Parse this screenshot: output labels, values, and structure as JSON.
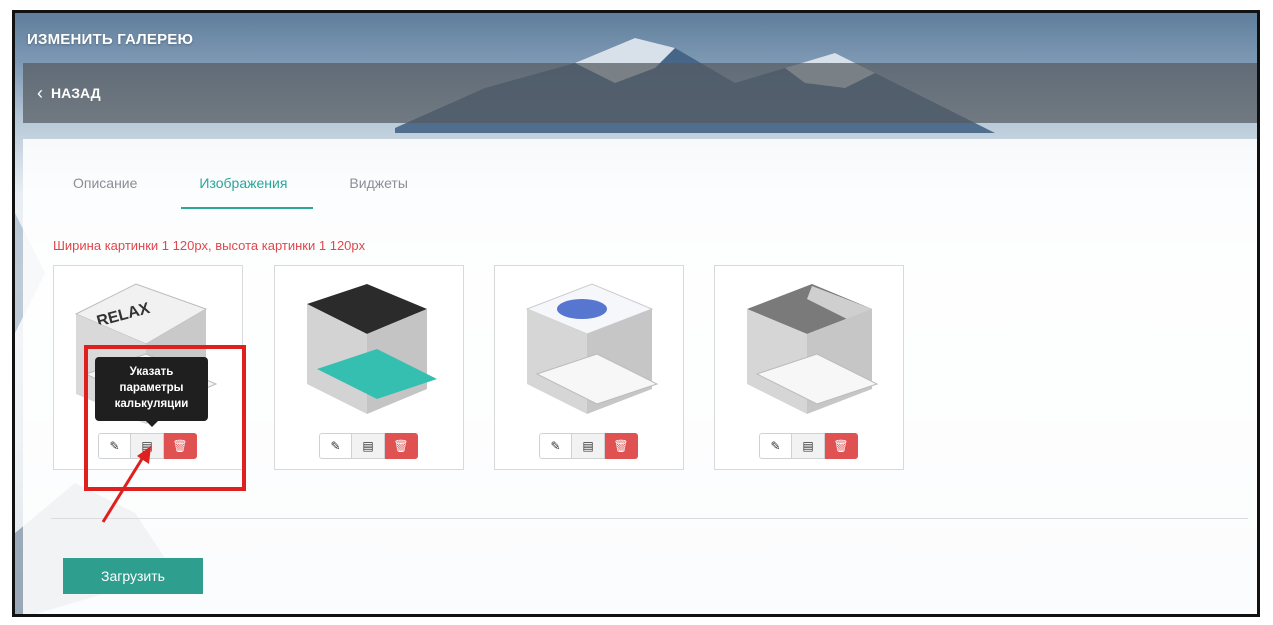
{
  "header": {
    "title": "ИЗМЕНИТЬ ГАЛЕРЕЮ",
    "back_label": "НАЗАД"
  },
  "tabs": [
    {
      "label": "Описание",
      "active": false
    },
    {
      "label": "Изображения",
      "active": true
    },
    {
      "label": "Виджеты",
      "active": false
    }
  ],
  "hint": "Ширина картинки 1 120px, высота картинки 1 120px",
  "gallery": {
    "items": [
      {
        "thumbnail": "business-cards-relax-refresh-renew"
      },
      {
        "thumbnail": "business-cards-black-white-portrait-teal"
      },
      {
        "thumbnail": "business-cards-blue-watercolor"
      },
      {
        "thumbnail": "business-cards-grey-photo"
      }
    ],
    "actions": {
      "edit_icon": "pencil-icon",
      "calc_icon": "calculator-icon",
      "delete_icon": "trash-icon"
    }
  },
  "tooltip": {
    "line1": "Указать",
    "line2": "параметры",
    "line3": "калькуляции"
  },
  "upload_label": "Загрузить",
  "colors": {
    "accent": "#2aa79a",
    "danger": "#e05252",
    "hint": "#e0474c",
    "highlight": "#e01f1f"
  }
}
